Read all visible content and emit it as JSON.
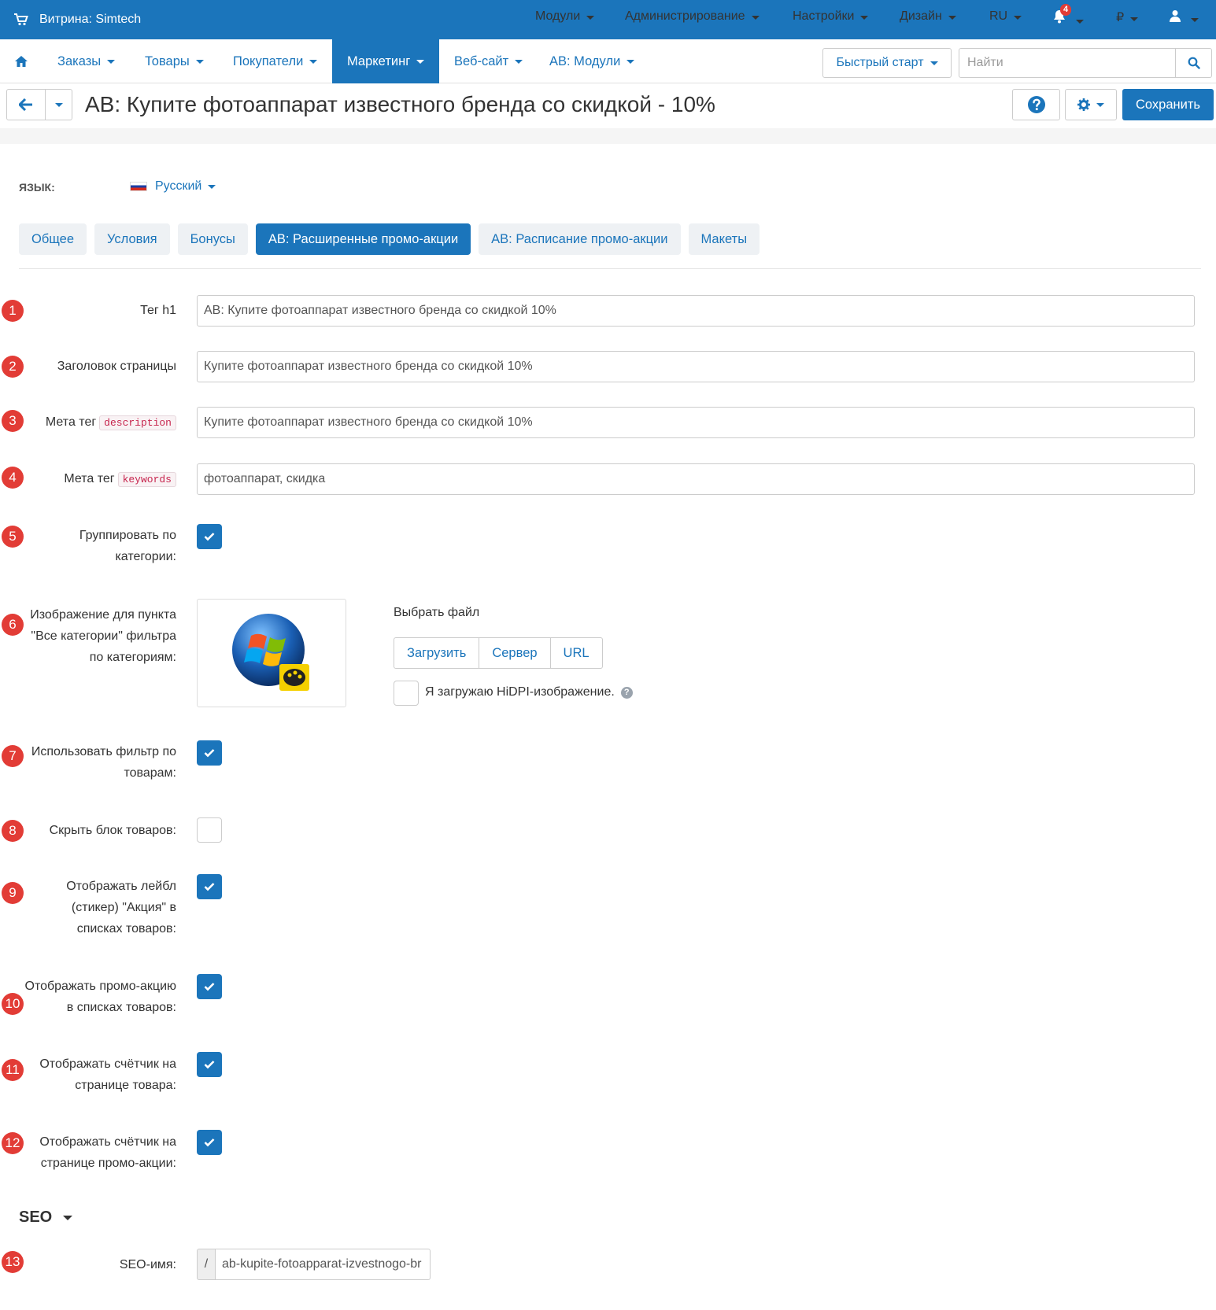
{
  "topbar": {
    "store": "Витрина: Simtech",
    "menu": [
      "Модули",
      "Администрирование",
      "Настройки",
      "Дизайн",
      "RU",
      "",
      "₽",
      ""
    ],
    "notification_count": "4"
  },
  "nav": {
    "items": [
      "Заказы",
      "Товары",
      "Покупатели",
      "Маркетинг",
      "Веб-сайт",
      "АВ: Модули"
    ],
    "active": "Маркетинг",
    "quick_start": "Быстрый старт",
    "search_placeholder": "Найти"
  },
  "page": {
    "title": "АВ: Купите фотоаппарат известного бренда со скидкой - 10%",
    "save_label": "Сохранить"
  },
  "language": {
    "label": "ЯЗЫК:",
    "value": "Русский"
  },
  "tabs": [
    "Общее",
    "Условия",
    "Бонусы",
    "АВ: Расширенные промо-акции",
    "АВ: Расписание промо-акции",
    "Макеты"
  ],
  "active_tab": "АВ: Расширенные промо-акции",
  "form": {
    "h1": {
      "num": "1",
      "label": "Тег h1",
      "value": "АВ: Купите фотоаппарат известного бренда со скидкой 10%"
    },
    "page_title": {
      "num": "2",
      "label": "Заголовок страницы",
      "value": "Купите фотоаппарат известного бренда со скидкой 10%"
    },
    "meta_desc": {
      "num": "3",
      "label": "Мета тег",
      "code": "description",
      "value": "Купите фотоаппарат известного бренда со скидкой 10%"
    },
    "meta_keys": {
      "num": "4",
      "label": "Мета тег",
      "code": "keywords",
      "value": "фотоаппарат, скидка"
    },
    "group_by_cat": {
      "num": "5",
      "label1": "Группировать по",
      "label2": "категории:",
      "checked": true
    },
    "image": {
      "num": "6",
      "label1": "Изображение для пункта",
      "label2": "\"Все категории\" фильтра",
      "label3": "по категориям:",
      "choose": "Выбрать файл",
      "buttons": [
        "Загрузить",
        "Сервер",
        "URL"
      ],
      "hidpi": "Я загружаю HiDPI-изображение."
    },
    "use_filter": {
      "num": "7",
      "label1": "Использовать фильтр по",
      "label2": "товарам:",
      "checked": true
    },
    "hide_block": {
      "num": "8",
      "label1": "Скрыть блок товаров:",
      "checked": false
    },
    "show_label": {
      "num": "9",
      "label1": "Отображать лейбл",
      "label2": "(стикер) \"Акция\" в",
      "label3": "списках товаров:",
      "checked": true
    },
    "show_promo": {
      "num": "10",
      "label1": "Отображать промо-акцию",
      "label2": "в списках товаров:",
      "checked": true
    },
    "counter_product": {
      "num": "11",
      "label1": "Отображать счётчик на",
      "label2": "странице товара:",
      "checked": true
    },
    "counter_promo": {
      "num": "12",
      "label1": "Отображать счётчик на",
      "label2": "странице промо-акции:",
      "checked": true
    }
  },
  "seo": {
    "heading": "SEO",
    "num": "13",
    "label": "SEO-имя:",
    "prefix": "/",
    "value": "ab-kupite-fotoapparat-izvestnogo-br"
  },
  "colors": {
    "primary": "#1b75bb",
    "badge": "#e23c36"
  }
}
